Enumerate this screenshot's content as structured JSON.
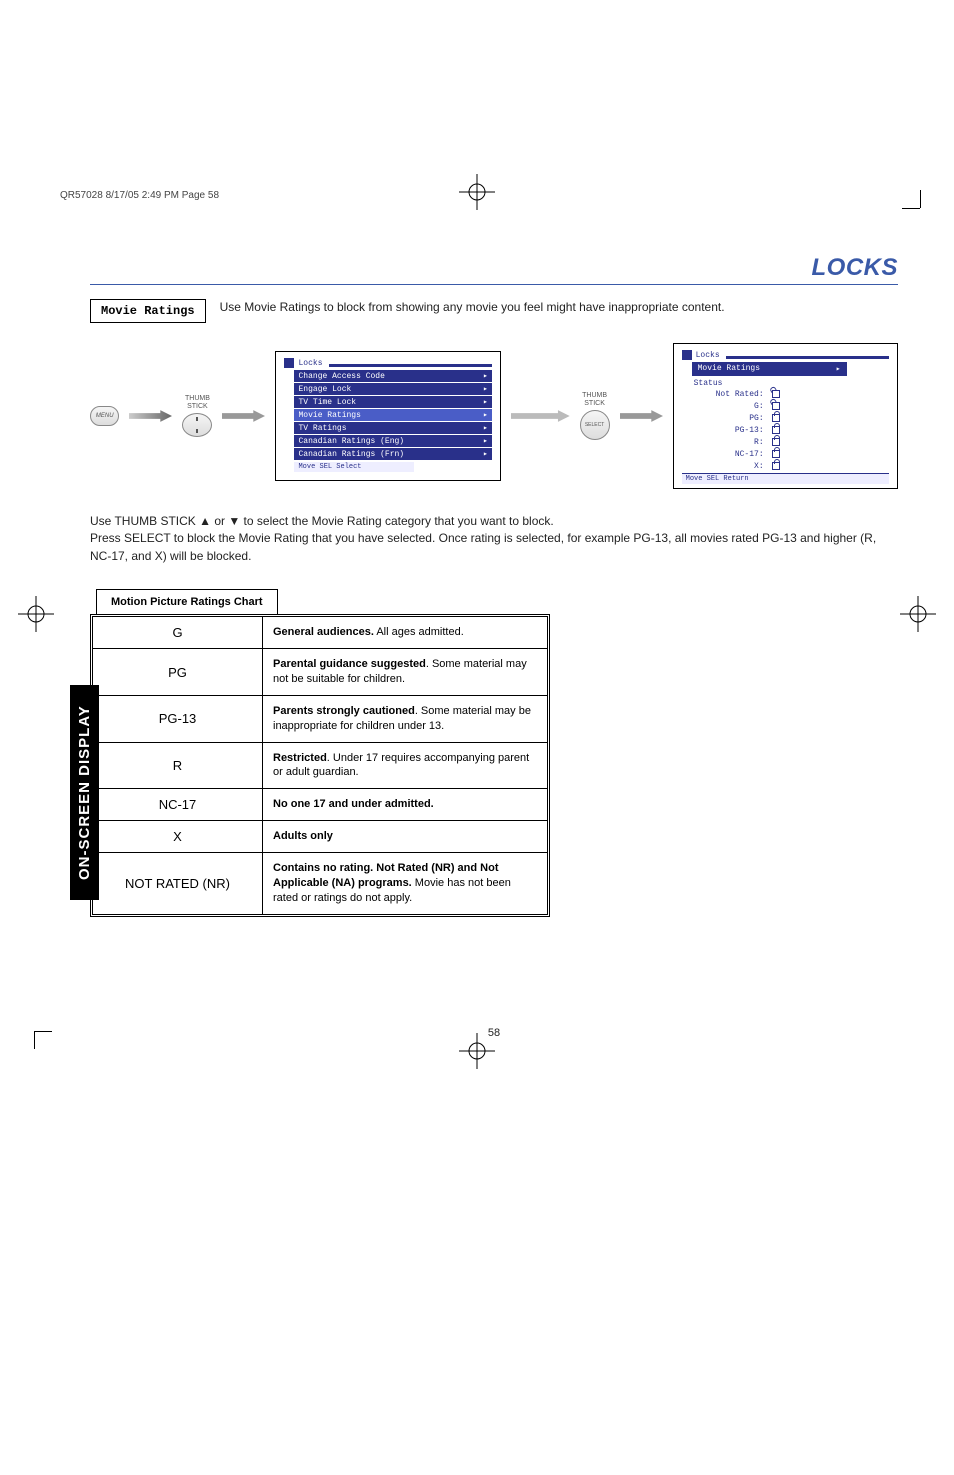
{
  "section_title": "LOCKS",
  "header_meta": "QR57028  8/17/05  2:49 PM  Page 58",
  "label_box": "Movie Ratings",
  "intro_text": "Use Movie Ratings to block from showing any movie you feel might have inappropriate content.",
  "thumb_caption": "THUMB\nSTICK",
  "menu_btn": "MENU",
  "select_btn": "SELECT",
  "osd1": {
    "title": "Locks",
    "items": [
      "Change Access Code",
      "Engage Lock",
      "TV Time Lock",
      "Movie Ratings",
      "TV Ratings",
      "Canadian Ratings (Eng)",
      "Canadian Ratings (Frn)"
    ],
    "highlight_index": 3,
    "footer": "  Move SEL Select"
  },
  "osd2": {
    "title": "Locks",
    "sub_item": "Movie Ratings",
    "status_label": "Status",
    "rows": [
      {
        "label": "Not Rated:",
        "open": true
      },
      {
        "label": "G:",
        "open": true
      },
      {
        "label": "PG:",
        "open": false
      },
      {
        "label": "PG-13:",
        "open": false
      },
      {
        "label": "R:",
        "open": false
      },
      {
        "label": "NC-17:",
        "open": false
      },
      {
        "label": "X:",
        "open": false
      }
    ],
    "footer": "  Move SEL Return"
  },
  "body_para_1": "Use THUMB STICK ▲ or ▼ to select the Movie Rating category that you want to block.",
  "body_para_2": "Press SELECT to block the Movie Rating that you have selected. Once rating is selected, for example PG-13, all movies rated PG-13 and higher (R, NC-17, and X) will be blocked.",
  "chart_label": "Motion Picture Ratings Chart",
  "ratings": [
    {
      "code": "G",
      "bold": "General audiences.",
      "rest": " All ages admitted."
    },
    {
      "code": "PG",
      "bold": "Parental guidance suggested",
      "rest": ". Some material may not be suitable for children."
    },
    {
      "code": "PG-13",
      "bold": "Parents strongly cautioned",
      "rest": ". Some material may be inappropriate for children under 13."
    },
    {
      "code": "R",
      "bold": "Restricted",
      "rest": ". Under 17 requires accompanying parent or adult guardian."
    },
    {
      "code": "NC-17",
      "bold": "No one 17 and under admitted.",
      "rest": ""
    },
    {
      "code": "X",
      "bold": "Adults only",
      "rest": ""
    },
    {
      "code": "NOT RATED (NR)",
      "bold": "Contains no rating. Not Rated (NR) and Not Applicable (NA) programs.",
      "rest": " Movie has not been rated or ratings do not apply."
    }
  ],
  "side_tab": "ON-SCREEN DISPLAY",
  "page_number": "58"
}
